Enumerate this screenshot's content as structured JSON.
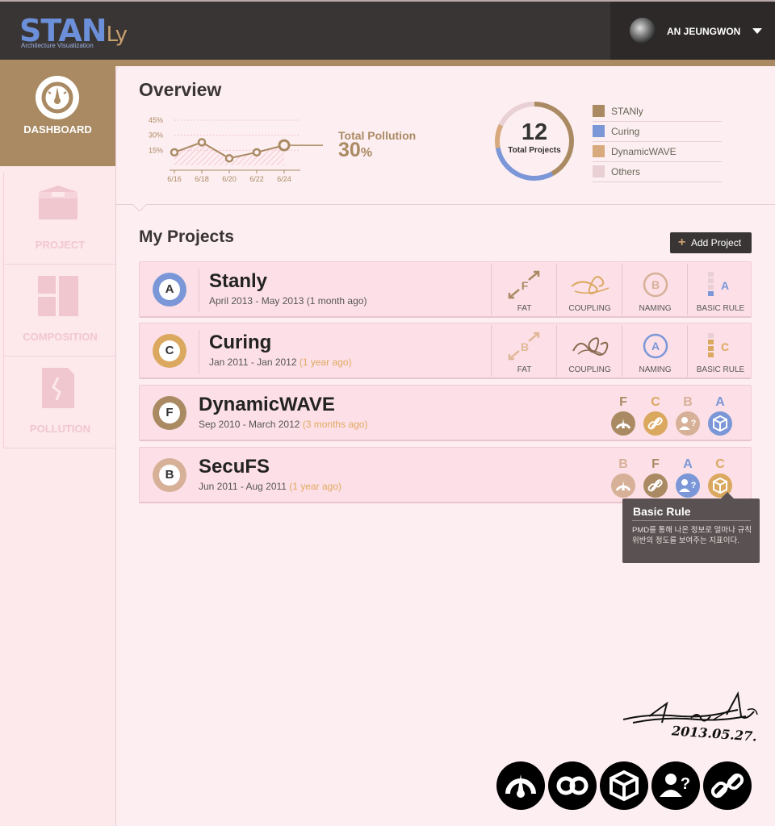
{
  "app": {
    "logo_main": "STAN",
    "logo_suffix": "Ly",
    "logo_sub": "Architecture Visualization",
    "user_name": "AN JEUNGWON"
  },
  "sidebar": {
    "items": [
      {
        "label": "DASHBOARD",
        "icon": "dashboard-gauge-icon",
        "active": true
      },
      {
        "label": "PROJECT",
        "icon": "project-box-icon",
        "active": false
      },
      {
        "label": "COMPOSITION",
        "icon": "composition-layout-icon",
        "active": false
      },
      {
        "label": "POLLUTION",
        "icon": "pollution-document-icon",
        "active": false
      }
    ]
  },
  "overview": {
    "title": "Overview",
    "chart_data": {
      "type": "line",
      "categories": [
        "6/16",
        "6/18",
        "6/20",
        "6/22",
        "6/24"
      ],
      "values": [
        13,
        23,
        7,
        13,
        20
      ],
      "yticks": [
        "45%",
        "30%",
        "15%"
      ],
      "ylim": [
        0,
        45
      ],
      "highlight_label": "Total Pollution",
      "highlight_value": "30",
      "highlight_unit": "%"
    },
    "donut": {
      "total": "12",
      "label": "Total Projects",
      "segments": [
        {
          "name": "STANly",
          "value": 0.42,
          "color": "#a98a63"
        },
        {
          "name": "Curing",
          "value": 0.3,
          "color": "#7b97d8"
        },
        {
          "name": "DynamicWAVE",
          "value": 0.1,
          "color": "#d7a97c"
        },
        {
          "name": "Others",
          "value": 0.18,
          "color": "#e8d0d5"
        }
      ]
    },
    "legend": [
      {
        "label": "STANly",
        "color": "#a98a63"
      },
      {
        "label": "Curing",
        "color": "#7b97d8"
      },
      {
        "label": "DynamicWAVE",
        "color": "#d7a97c"
      },
      {
        "label": "Others",
        "color": "#e8d0d5"
      }
    ]
  },
  "projects": {
    "title": "My Projects",
    "add_label": "Add Project",
    "metric_labels": [
      "FAT",
      "COUPLING",
      "NAMING",
      "BASIC RULE"
    ],
    "list": [
      {
        "name": "Stanly",
        "grade": "A",
        "grade_color": "#7b97d8",
        "date": "April 2013 - May 2013 (1 month ago)",
        "ago": "",
        "metrics": [
          "F",
          "",
          "B",
          "A"
        ]
      },
      {
        "name": "Curing",
        "grade": "C",
        "grade_color": "#dba860",
        "date": "Jan 2011 - Jan 2012 ",
        "ago": "(1 year ago)",
        "metrics": [
          "B",
          "",
          "A",
          "C"
        ]
      },
      {
        "name": "DynamicWAVE",
        "grade": "F",
        "grade_color": "#a98a63",
        "date": "Sep 2010 - March 2012 ",
        "ago": "(3 months ago)",
        "badges": [
          "F",
          "C",
          "B",
          "A"
        ]
      },
      {
        "name": "SecuFS",
        "grade": "B",
        "grade_color": "#d7b098",
        "date": "Jun 2011 - Aug 2011 ",
        "ago": "(1 year ago)",
        "badges": [
          "B",
          "F",
          "A",
          "C"
        ]
      }
    ]
  },
  "tooltip": {
    "title": "Basic Rule",
    "body": "PMD를 통해 나온 정보로 얼마나 규칙 위반의 정도를 보여주는 지표이다."
  },
  "signature": {
    "date": "2013.05.27."
  },
  "colors": {
    "grade_A": "#7b97d8",
    "grade_B": "#d7b098",
    "grade_C": "#dba860",
    "grade_F": "#a98a63"
  }
}
